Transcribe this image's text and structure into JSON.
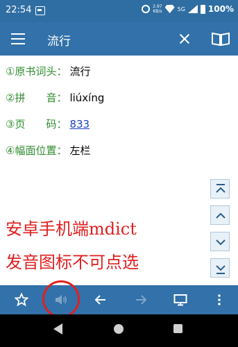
{
  "status_bar": {
    "time": "22:54",
    "speed_top": "2.97",
    "speed_bottom": "KB/s",
    "network": "5G",
    "battery": "100%"
  },
  "app_bar": {
    "title": "流行",
    "icons": [
      "menu-icon",
      "close-icon",
      "book-icon"
    ]
  },
  "entry": [
    {
      "label": "①原书词头：",
      "value": "流行"
    },
    {
      "label": "②拼　　音：",
      "value": "liúxíng"
    },
    {
      "label": "③页　　码：",
      "value": "833"
    },
    {
      "label": "④幅面位置：",
      "value": "左栏"
    }
  ],
  "side_buttons": [
    "top-icon",
    "up-icon",
    "down-icon",
    "bottom-icon"
  ],
  "annotation": {
    "line1": "安卓手机端mdict",
    "line2": "发音图标不可点选",
    "color": "#e02020"
  },
  "toolbar": {
    "icons": [
      "star-icon",
      "speaker-icon",
      "back-arrow-icon",
      "forward-arrow-icon",
      "monitor-icon",
      "more-icon"
    ],
    "bg": "#3271a9"
  }
}
